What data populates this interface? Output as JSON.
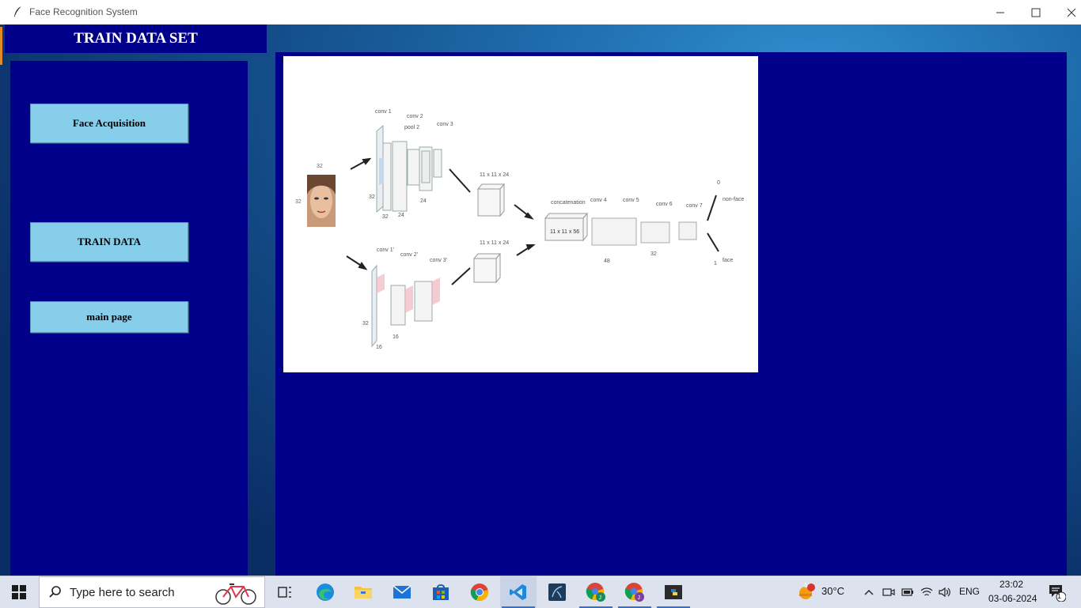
{
  "window": {
    "title": "Face Recognition System"
  },
  "header": {
    "title": "TRAIN DATA SET"
  },
  "sidebar": {
    "buttons": [
      {
        "label": "Face Acquisition"
      },
      {
        "label": "TRAIN DATA"
      },
      {
        "label": "main page"
      }
    ]
  },
  "diagram": {
    "labels": {
      "input_size_top": "32",
      "input_size_side": "32",
      "conv1": "conv 1",
      "conv2": "conv 2",
      "pool2": "pool 2",
      "conv3": "conv 3",
      "vol_top": "11 x 11 x 24",
      "vol_bottom": "11 x 11 x 24",
      "concat": "concatenation",
      "concat_size": "11 x 11 x 56",
      "conv4": "conv 4",
      "conv5": "conv 5",
      "conv6": "conv 6",
      "conv7": "conv 7",
      "conv1b": "conv 1'",
      "conv2b": "conv 2'",
      "conv3b": "conv 3'",
      "out0": "0",
      "out1": "1",
      "nonface": "non-face",
      "face": "face",
      "n32a": "32",
      "n24a": "24",
      "n24b": "24",
      "n32b": "32",
      "n16": "16",
      "n48": "48",
      "n32c": "32",
      "n16b": "16"
    }
  },
  "taskbar": {
    "search_placeholder": "Type here to search",
    "weather": "30°C",
    "weather_badge": "1",
    "language": "ENG",
    "time": "23:02",
    "date": "03-06-2024",
    "notification_count": "1"
  },
  "colors": {
    "panel": "#00008b",
    "button": "#87ceeb",
    "accent": "#2f6fd6"
  }
}
